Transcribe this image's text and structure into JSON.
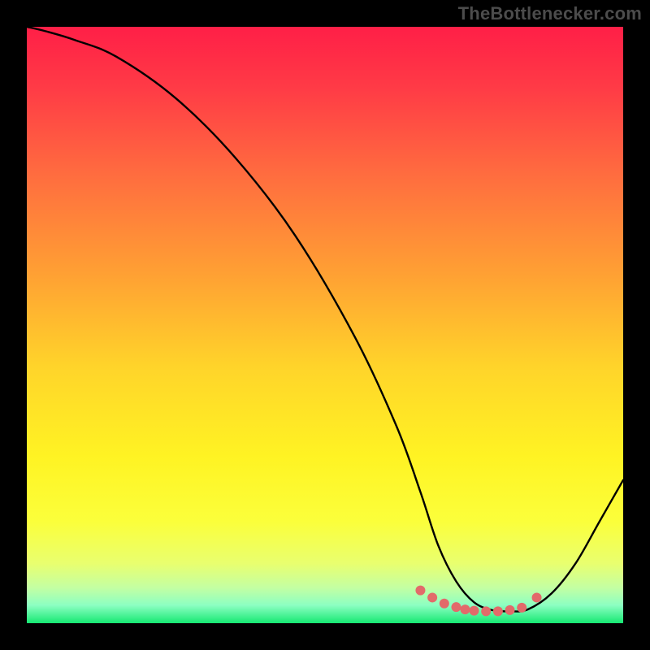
{
  "watermark": "TheBottlenecker.com",
  "chart_data": {
    "type": "line",
    "title": "",
    "xlabel": "",
    "ylabel": "",
    "xlim": [
      0,
      100
    ],
    "ylim": [
      0,
      100
    ],
    "grid": false,
    "background_gradient": {
      "stops": [
        {
          "offset": 0.0,
          "color": "#ff1f47"
        },
        {
          "offset": 0.1,
          "color": "#ff3a46"
        },
        {
          "offset": 0.25,
          "color": "#ff6d3f"
        },
        {
          "offset": 0.42,
          "color": "#ffa233"
        },
        {
          "offset": 0.57,
          "color": "#ffd42a"
        },
        {
          "offset": 0.72,
          "color": "#fff323"
        },
        {
          "offset": 0.83,
          "color": "#fbff3b"
        },
        {
          "offset": 0.9,
          "color": "#e9ff6f"
        },
        {
          "offset": 0.94,
          "color": "#c4ffa2"
        },
        {
          "offset": 0.97,
          "color": "#8cffc2"
        },
        {
          "offset": 1.0,
          "color": "#16e872"
        }
      ]
    },
    "series": [
      {
        "name": "bottleneck-curve",
        "color": "#000000",
        "x": [
          0,
          3,
          8,
          15,
          25,
          35,
          45,
          55,
          62,
          66,
          69,
          72,
          75,
          78,
          81,
          84,
          88,
          92,
          96,
          100
        ],
        "values": [
          100,
          99.3,
          97.8,
          95,
          88,
          78,
          65,
          48,
          33,
          22,
          13,
          7,
          3.5,
          2.2,
          2.0,
          2.3,
          5,
          10,
          17,
          24
        ]
      }
    ],
    "markers": {
      "name": "minimum-band",
      "color": "#e26a6a",
      "radius": 6,
      "x": [
        66,
        68,
        70,
        72,
        73.5,
        75,
        77,
        79,
        81,
        83,
        85.5
      ],
      "values": [
        5.5,
        4.3,
        3.3,
        2.7,
        2.3,
        2.1,
        2.0,
        2.0,
        2.2,
        2.6,
        4.3
      ]
    }
  }
}
